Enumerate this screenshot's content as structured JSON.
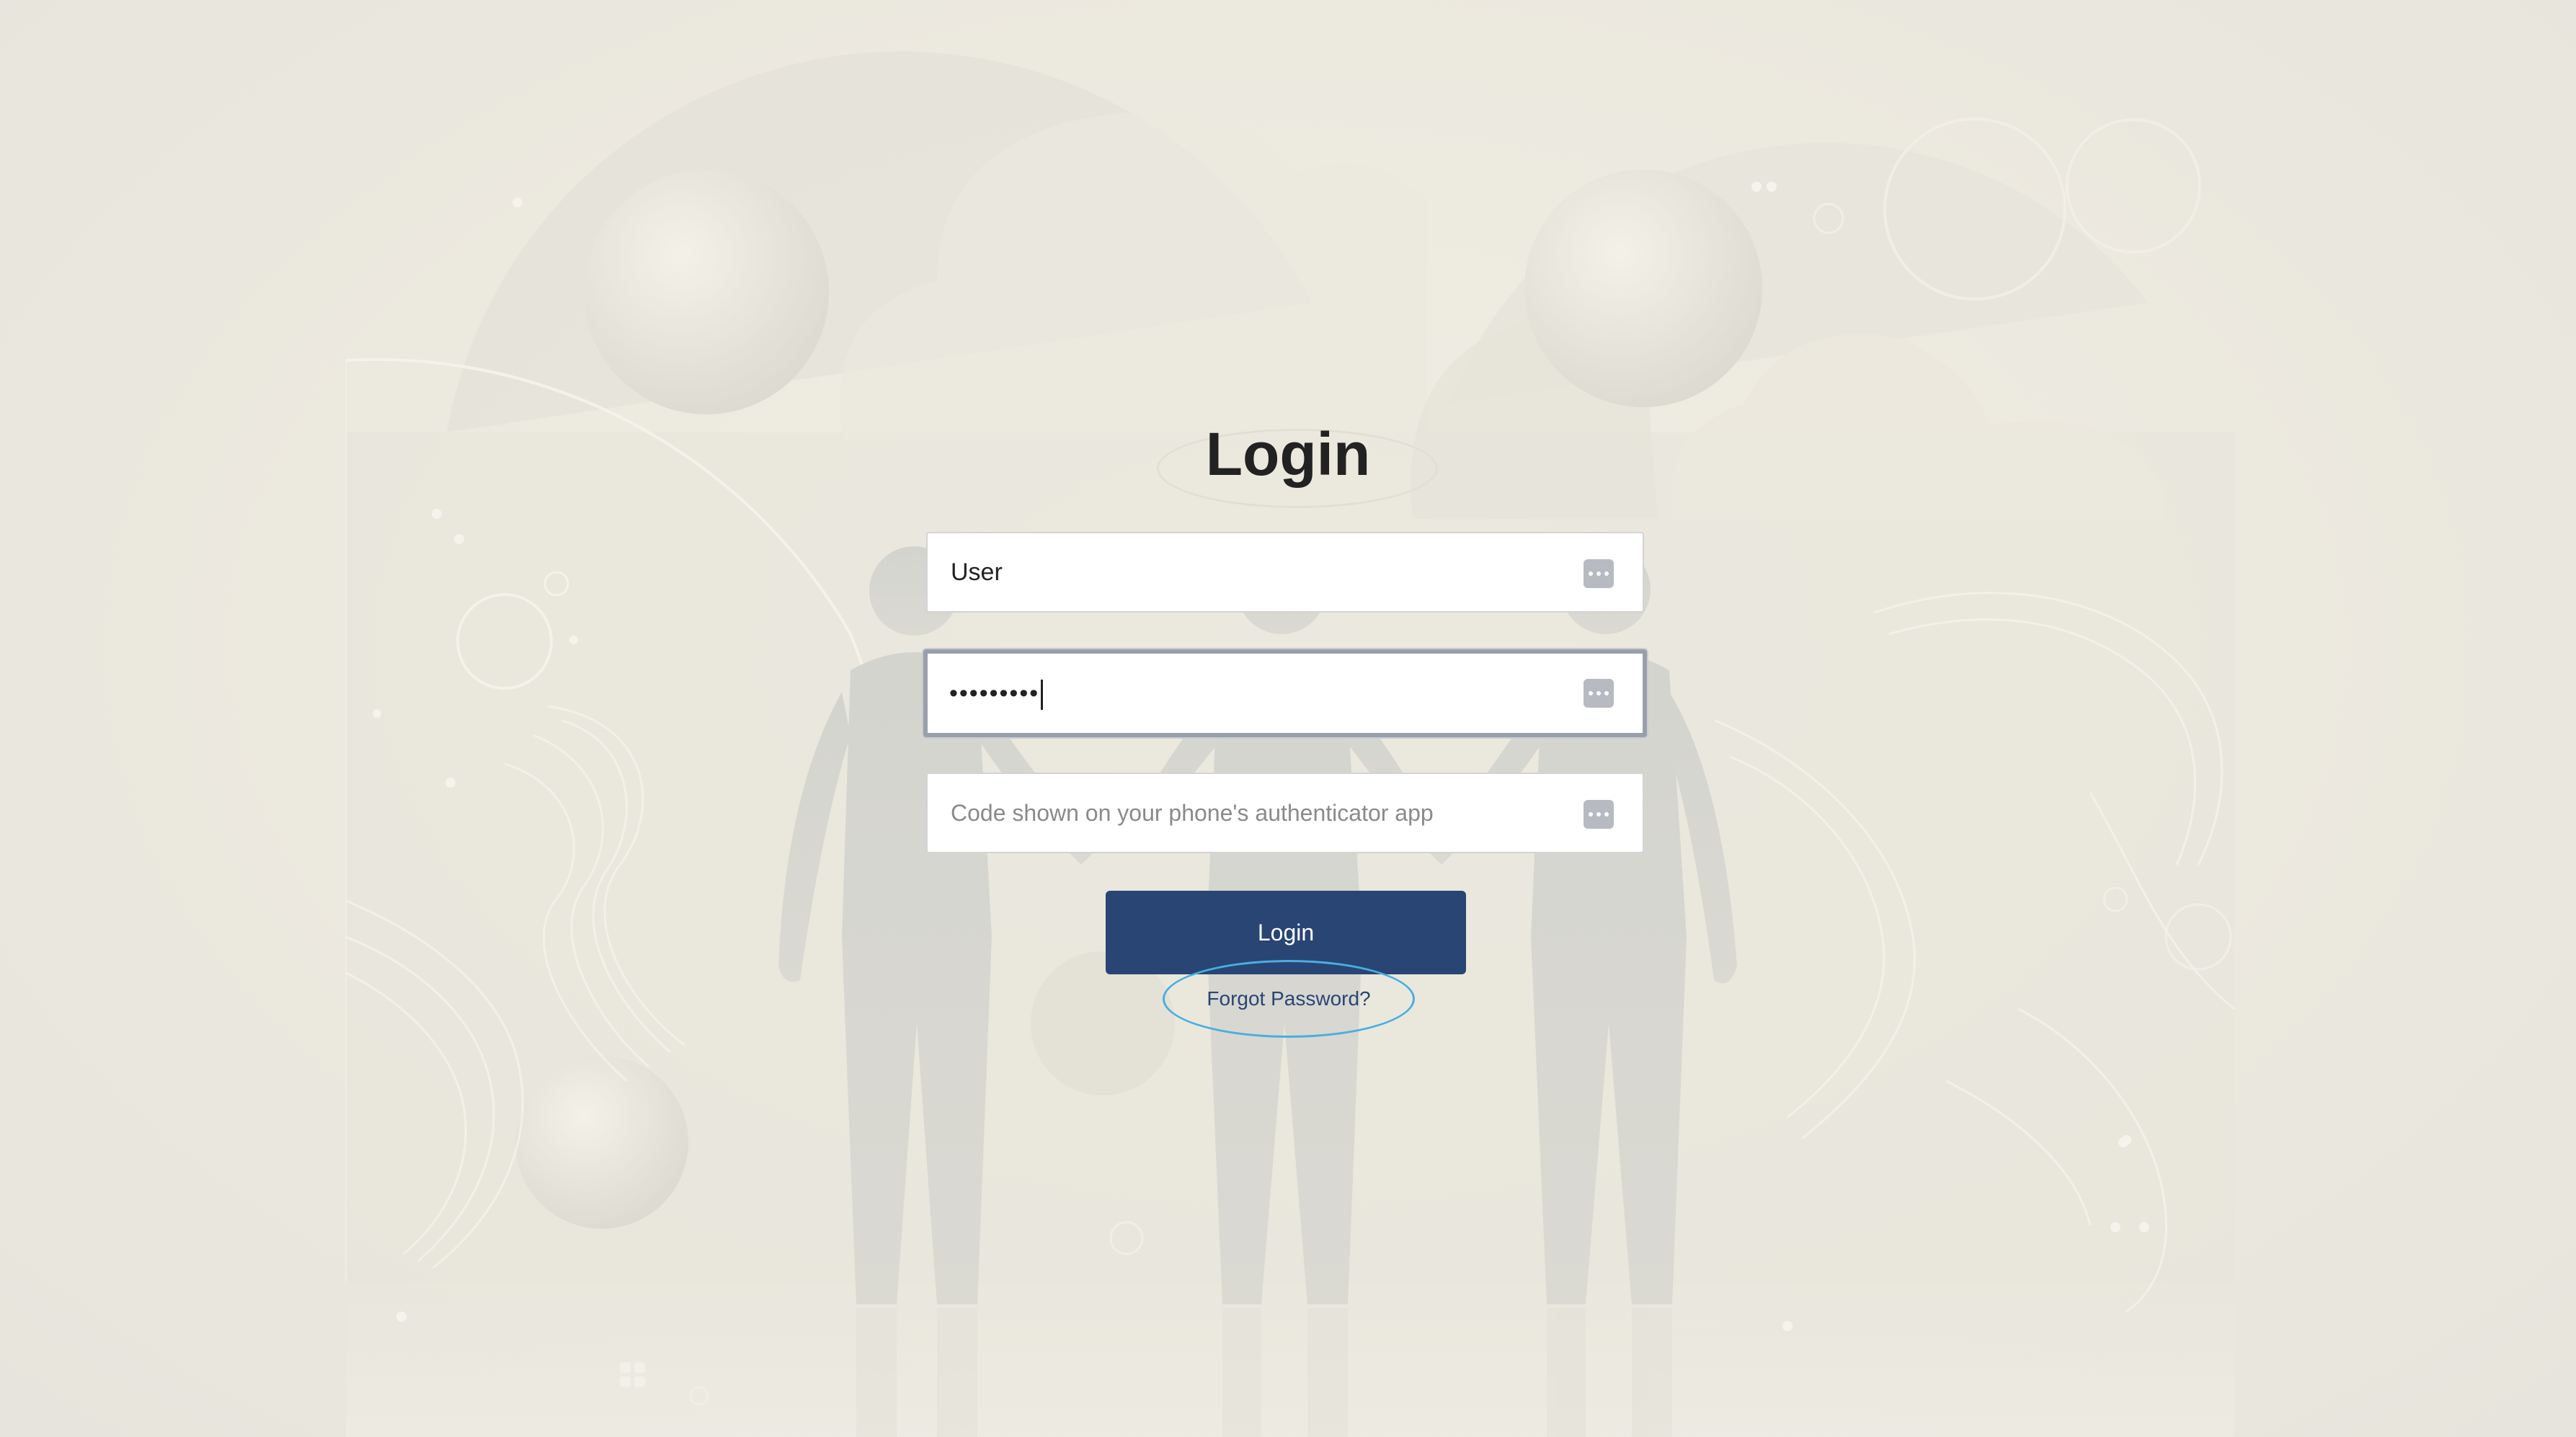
{
  "page": {
    "title": "Login"
  },
  "form": {
    "username": {
      "value": "User"
    },
    "password": {
      "value": "•••••••••"
    },
    "otp": {
      "placeholder": "Code shown on your phone's authenticator app"
    },
    "field_icon": "password-manager-key-icon",
    "login_button_label": "Login",
    "forgot_password_label": "Forgot Password?"
  },
  "colors": {
    "primary_button": "#284574",
    "link": "#284574",
    "focus_ring": "#9aa0aa",
    "highlight_ring": "#4aaee0",
    "background": "#ece9df"
  }
}
